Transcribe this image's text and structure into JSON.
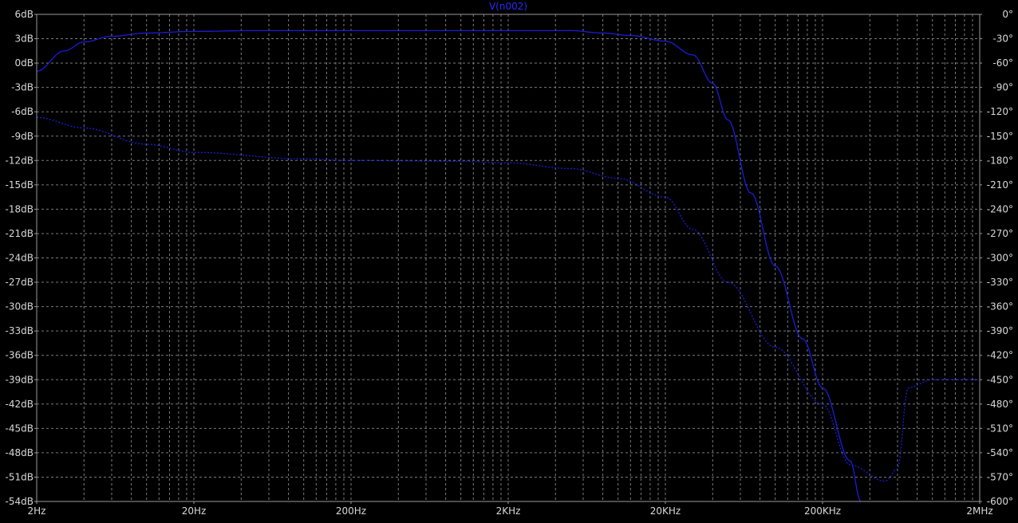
{
  "chart_data": {
    "type": "line",
    "title": "V(n002)",
    "colors": {
      "background": "#000000",
      "frame": "#9a9a9a",
      "grid": "#7a7a7a",
      "tick_label": "#d8d8d8",
      "trace": "#1c1cd8",
      "title": "#2a2aff"
    },
    "x_axis": {
      "scale": "log",
      "range_hz": [
        2,
        2000000
      ],
      "tick_values_hz": [
        2,
        20,
        200,
        2000,
        20000,
        200000,
        2000000
      ],
      "tick_labels": [
        "2Hz",
        "20Hz",
        "200Hz",
        "2KHz",
        "20KHz",
        "200KHz",
        "2MHz"
      ]
    },
    "y_left": {
      "unit": "dB",
      "range": [
        -54,
        6
      ],
      "tick_labels": [
        "6dB",
        "3dB",
        "0dB",
        "-3dB",
        "-6dB",
        "-9dB",
        "-12dB",
        "-15dB",
        "-18dB",
        "-21dB",
        "-24dB",
        "-27dB",
        "-30dB",
        "-33dB",
        "-36dB",
        "-39dB",
        "-42dB",
        "-45dB",
        "-48dB",
        "-51dB",
        "-54dB"
      ]
    },
    "y_right": {
      "unit": "degrees",
      "range": [
        -600,
        0
      ],
      "tick_labels": [
        "0°",
        "-30°",
        "-60°",
        "-90°",
        "-120°",
        "-150°",
        "-180°",
        "-210°",
        "-240°",
        "-270°",
        "-300°",
        "-330°",
        "-360°",
        "-390°",
        "-420°",
        "-450°",
        "-480°",
        "-510°",
        "-540°",
        "-570°",
        "-600°"
      ]
    },
    "grid": true,
    "series": [
      {
        "style": "solid",
        "axis": "left",
        "x": [
          2,
          3,
          4,
          6,
          10,
          20,
          50,
          200,
          2000,
          5000,
          8000,
          12000,
          20000,
          30000,
          40000,
          50000,
          70000,
          100000,
          150000,
          200000,
          300000,
          350000
        ],
        "values": [
          -1.0,
          1.5,
          2.6,
          3.3,
          3.7,
          3.9,
          4.0,
          4.0,
          4.0,
          4.0,
          3.7,
          3.4,
          2.7,
          1.0,
          -2.5,
          -7.0,
          -16.0,
          -25.0,
          -34.0,
          -40.0,
          -49.0,
          -54.0
        ]
      },
      {
        "style": "dotted",
        "axis": "right",
        "x": [
          2,
          4,
          10,
          20,
          100,
          200,
          1000,
          2000,
          5000,
          10000,
          20000,
          30000,
          50000,
          100000,
          200000,
          300000,
          500000,
          600000,
          700000,
          1000000,
          2000000
        ],
        "values": [
          -127,
          -140,
          -160,
          -170,
          -178,
          -180,
          -181,
          -183,
          -190,
          -202,
          -225,
          -265,
          -330,
          -410,
          -480,
          -555,
          -575,
          -560,
          -460,
          -450,
          -450
        ]
      }
    ]
  }
}
